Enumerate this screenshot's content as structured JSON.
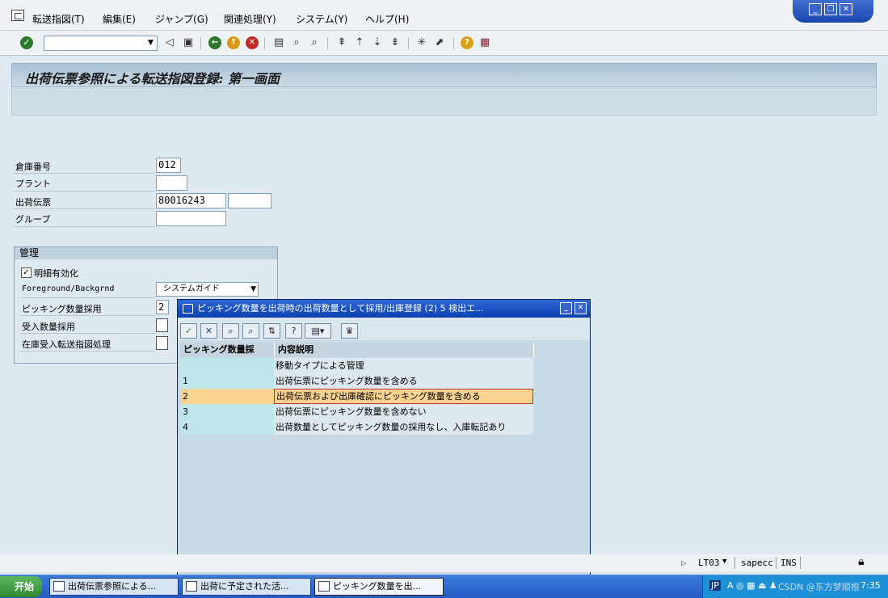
{
  "menu": {
    "items": [
      "転送指図(T)",
      "編集(E)",
      "ジャンプ(G)",
      "関連処理(Y)",
      "システム(Y)",
      "ヘルプ(H)"
    ]
  },
  "window_controls": {
    "minimize": "_",
    "restore": "❐",
    "close": "✕"
  },
  "toolbar": {
    "command_field": "",
    "icons": [
      "enter-icon",
      "back-icon",
      "save-icon",
      "back-nav-icon",
      "exit-icon",
      "cancel-icon",
      "print-icon",
      "find-icon",
      "find-next-icon",
      "first-page-icon",
      "prev-page-icon",
      "next-page-icon",
      "last-page-icon",
      "new-session-icon",
      "shortcut-icon",
      "help-icon",
      "layout-icon"
    ]
  },
  "page": {
    "title": "出荷伝票参照による転送指図登録: 第一画面"
  },
  "form": {
    "warehouse_label": "倉庫番号",
    "warehouse_value": "012",
    "plant_label": "プラント",
    "plant_value": "",
    "delivery_label": "出荷伝票",
    "delivery_value": "80016243",
    "delivery_value2": "",
    "group_label": "グループ",
    "group_value": ""
  },
  "control": {
    "title": "管理",
    "detail_active_label": "明細有効化",
    "detail_active_checked": "✓",
    "fg_bg_label": "Foreground/Backgrnd",
    "fg_bg_value": "システムガイド",
    "picking_qty_label": "ピッキング数量採用",
    "picking_qty_value": "2",
    "receipt_qty_label": "受入数量採用",
    "stock_transfer_label": "在庫受入転送指図処理"
  },
  "popup": {
    "title": "ピッキング数量を出荷時の出荷数量として採用/出庫登録 (2)    5 検出エ...",
    "col1": "ピッキング数量採",
    "col2": "内容説明",
    "rows": [
      {
        "code": "",
        "text": "移動タイプによる管理"
      },
      {
        "code": "1",
        "text": "出荷伝票にピッキング数量を含める"
      },
      {
        "code": "2",
        "text": "出荷伝票および出庫確認にピッキング数量を含める"
      },
      {
        "code": "3",
        "text": "出荷伝票にピッキング数量を含めない"
      },
      {
        "code": "4",
        "text": "出荷数量としてピッキング数量の採用なし、入庫転記あり"
      }
    ],
    "selected_index": 2
  },
  "status": {
    "transaction": "LT03",
    "system": "sapecc",
    "mode": "INS"
  },
  "taskbar": {
    "start": "开始",
    "tasks": [
      "出荷伝票参照による...",
      "出荷に予定された活...",
      "ピッキング数量を出..."
    ],
    "tray_lang": "JP",
    "watermark": "CSDN @东方梦顺根",
    "clock": "7:35"
  },
  "colors": {
    "title_accent": "#a9c2d4",
    "popup_title": "#2e69d6",
    "selected_row": "#fbd390"
  }
}
